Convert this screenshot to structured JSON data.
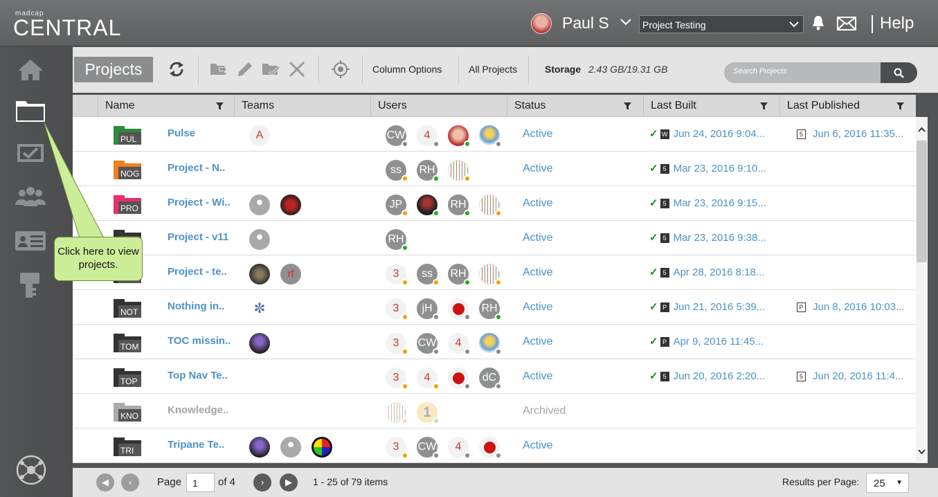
{
  "header": {
    "brand_small": "madcap",
    "brand": "CENTRAL",
    "user_name": "Paul S",
    "project_select": "Project Testing",
    "help": "Help",
    "icons": [
      "user-avatar",
      "chevron-down-icon",
      "bell-icon",
      "mail-icon"
    ]
  },
  "sidebar": {
    "items": [
      "home-icon",
      "folder-icon",
      "tasks-icon",
      "users-icon",
      "license-icon",
      "key-icon",
      "network-icon"
    ]
  },
  "callout": {
    "text": "Click here to view projects."
  },
  "toolbar": {
    "title": "Projects",
    "column_options": "Column Options",
    "all_projects": "All Projects",
    "storage_label": "Storage",
    "storage_value": "2.43 GB/19.31 GB",
    "search_placeholder": "Search Projects"
  },
  "columns": [
    "Name",
    "Teams",
    "Users",
    "Status",
    "Last Built",
    "Last Published"
  ],
  "rows": [
    {
      "folder_color": "#2e8b3e",
      "abbr": "PUL",
      "name": "Pulse",
      "teams": [
        {
          "t": "A",
          "light": true
        }
      ],
      "users": [
        {
          "t": "CW",
          "dot": "#888"
        },
        {
          "t": "4",
          "light": true,
          "dot": "#888"
        },
        {
          "t": "",
          "img": "face",
          "dot": "#2a2"
        },
        {
          "t": "",
          "img": "char",
          "dot": "#888"
        }
      ],
      "status": "Active",
      "built": "Jun 24, 2016 9:04...",
      "built_icon": "W",
      "published": "Jun 6, 2016 11:35...",
      "pub_icon": "5"
    },
    {
      "folder_color": "#f08020",
      "abbr": "NOG",
      "name": "Project - N..",
      "teams": [],
      "users": [
        {
          "t": "ss",
          "dot": "#f5a000"
        },
        {
          "t": "RH",
          "dot": "#2a2"
        },
        {
          "t": "",
          "img": "dots",
          "dot": "#f5a000"
        }
      ],
      "status": "Active",
      "built": "Mar 23, 2016 9:10...",
      "built_icon": "5",
      "published": "",
      "pub_icon": ""
    },
    {
      "folder_color": "#e8306a",
      "abbr": "PRO",
      "name": "Project - Wi..",
      "teams": [
        {
          "t": "",
          "img": "group"
        },
        {
          "t": "",
          "img": "red"
        }
      ],
      "users": [
        {
          "t": "JP",
          "dot": "#f5a000"
        },
        {
          "t": "",
          "img": "dark",
          "dot": "#2a2"
        },
        {
          "t": "RH",
          "dot": "#2a2"
        },
        {
          "t": "",
          "img": "dots",
          "dot": "#f5a000"
        }
      ],
      "status": "Active",
      "built": "Mar 23, 2016 9:15...",
      "built_icon": "5",
      "published": "",
      "pub_icon": ""
    },
    {
      "folder_color": "#333",
      "abbr": "",
      "name": "Project - v11",
      "teams": [
        {
          "t": "",
          "img": "group"
        }
      ],
      "users": [
        {
          "t": "RH",
          "dot": "#2a2"
        }
      ],
      "status": "Active",
      "built": "Mar 23, 2016 9:38...",
      "built_icon": "5",
      "published": "",
      "pub_icon": ""
    },
    {
      "folder_color": "#333",
      "abbr": "",
      "name": "Project - te..",
      "teams": [
        {
          "t": "",
          "img": "forest"
        },
        {
          "t": "rf",
          "img": "rf"
        }
      ],
      "users": [
        {
          "t": "3",
          "light": true,
          "dot": "#f5a000"
        },
        {
          "t": "ss",
          "dot": "#f5a000"
        },
        {
          "t": "RH",
          "dot": "#2a2"
        },
        {
          "t": "",
          "img": "dots",
          "dot": "#f5a000"
        }
      ],
      "status": "Active",
      "built": "Apr 28, 2016 8:18...",
      "built_icon": "5",
      "published": "",
      "pub_icon": ""
    },
    {
      "folder_color": "#333",
      "abbr": "NOT",
      "name": "Nothing in..",
      "teams": [
        {
          "t": "",
          "img": "bug"
        }
      ],
      "users": [
        {
          "t": "3",
          "light": true,
          "dot": "#f5a000"
        },
        {
          "t": "jH",
          "dot": "#888"
        },
        {
          "t": "",
          "img": "apple",
          "dot": "#888"
        },
        {
          "t": "RH",
          "dot": "#2a2"
        }
      ],
      "status": "Active",
      "built": "Jun 21, 2016 5:39...",
      "built_icon": "P",
      "published": "Jun 8, 2016 10:03...",
      "pub_icon": "P"
    },
    {
      "folder_color": "#333",
      "abbr": "TOM",
      "name": "TOC missin..",
      "teams": [
        {
          "t": "",
          "img": "purple"
        }
      ],
      "users": [
        {
          "t": "3",
          "light": true,
          "dot": "#f5a000"
        },
        {
          "t": "CW",
          "dot": "#888"
        },
        {
          "t": "4",
          "light": true,
          "dot": "#888"
        },
        {
          "t": "",
          "img": "char",
          "dot": "#888"
        }
      ],
      "status": "Active",
      "built": "Apr 9, 2016 11:45...",
      "built_icon": "P",
      "published": "",
      "pub_icon": ""
    },
    {
      "folder_color": "#333",
      "abbr": "TOP",
      "name": "Top Nav Te..",
      "teams": [],
      "users": [
        {
          "t": "3",
          "light": true,
          "dot": "#f5a000"
        },
        {
          "t": "4",
          "light": true,
          "dot": "#f5a000"
        },
        {
          "t": "",
          "img": "apple",
          "dot": "#888"
        },
        {
          "t": "dC",
          "dot": "#888"
        }
      ],
      "status": "Active",
      "built": "Jun 20, 2016 2:20...",
      "built_icon": "5",
      "published": "Jun 20, 2016 11:4...",
      "pub_icon": "5"
    },
    {
      "folder_color": "#aaa",
      "abbr": "KNO",
      "name": "Knowledge..",
      "archived": true,
      "teams": [],
      "users": [
        {
          "t": "",
          "img": "dots",
          "dot": "#f5c070"
        },
        {
          "t": "1",
          "img": "one",
          "dot": "#8c8"
        }
      ],
      "status": "Archived",
      "built": "",
      "built_icon": "",
      "published": "",
      "pub_icon": ""
    },
    {
      "folder_color": "#333",
      "abbr": "TRI",
      "name": "Tripane Te..",
      "teams": [
        {
          "t": "",
          "img": "purple"
        },
        {
          "t": "",
          "img": "group"
        },
        {
          "t": "",
          "img": "color"
        }
      ],
      "users": [
        {
          "t": "3",
          "light": true,
          "dot": "#f5a000"
        },
        {
          "t": "CW",
          "dot": "#888"
        },
        {
          "t": "4",
          "light": true,
          "dot": "#888"
        },
        {
          "t": "",
          "img": "apple",
          "dot": "#888"
        }
      ],
      "status": "Active",
      "built": "",
      "built_icon": "",
      "published": "",
      "pub_icon": ""
    }
  ],
  "pager": {
    "page_label": "Page",
    "page_value": "1",
    "of_label": "of 4",
    "items_label": "1 - 25 of 79 items",
    "rpp_label": "Results per Page:",
    "rpp_value": "25"
  }
}
